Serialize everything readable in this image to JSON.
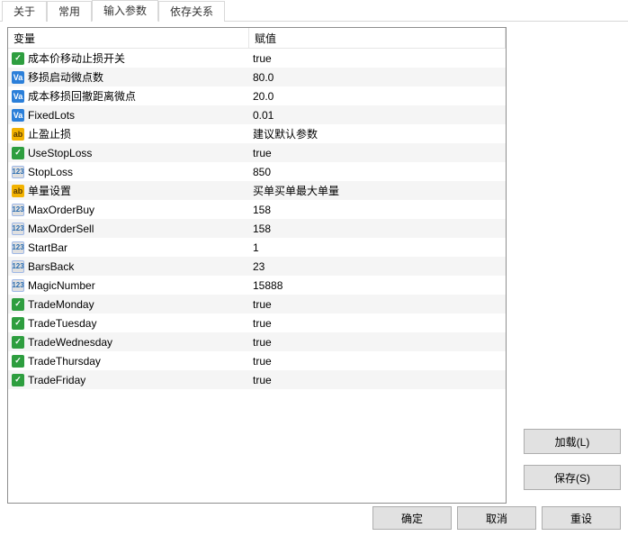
{
  "tabs": {
    "about": "关于",
    "common": "常用",
    "inputs": "输入参数",
    "deps": "依存关系"
  },
  "headers": {
    "variable": "变量",
    "value": "赋值"
  },
  "rows": [
    {
      "icon": "bool",
      "name": "成本价移动止损开关",
      "value": "true"
    },
    {
      "icon": "dbl",
      "name": "移损启动微点数",
      "value": "80.0"
    },
    {
      "icon": "dbl",
      "name": "成本移损回撤距离微点",
      "value": "20.0"
    },
    {
      "icon": "dbl",
      "name": "FixedLots",
      "value": "0.01"
    },
    {
      "icon": "str",
      "name": "止盈止损",
      "value": "建议默认参数"
    },
    {
      "icon": "bool",
      "name": "UseStopLoss",
      "value": "true"
    },
    {
      "icon": "int",
      "name": "StopLoss",
      "value": "850"
    },
    {
      "icon": "str",
      "name": "单量设置",
      "value": "买单买单最大单量"
    },
    {
      "icon": "int",
      "name": "MaxOrderBuy",
      "value": "158"
    },
    {
      "icon": "int",
      "name": "MaxOrderSell",
      "value": "158"
    },
    {
      "icon": "int",
      "name": "StartBar",
      "value": "1"
    },
    {
      "icon": "int",
      "name": "BarsBack",
      "value": "23"
    },
    {
      "icon": "int",
      "name": "MagicNumber",
      "value": "15888"
    },
    {
      "icon": "bool",
      "name": "TradeMonday",
      "value": "true"
    },
    {
      "icon": "bool",
      "name": "TradeTuesday",
      "value": "true"
    },
    {
      "icon": "bool",
      "name": "TradeWednesday",
      "value": "true"
    },
    {
      "icon": "bool",
      "name": "TradeThursday",
      "value": "true"
    },
    {
      "icon": "bool",
      "name": "TradeFriday",
      "value": "true"
    }
  ],
  "buttons": {
    "load": "加载(L)",
    "save": "保存(S)",
    "ok": "确定",
    "cancel": "取消",
    "reset": "重设"
  },
  "icon_glyphs": {
    "bool": "✓",
    "dbl": "Va",
    "int": "123",
    "str": "ab"
  }
}
